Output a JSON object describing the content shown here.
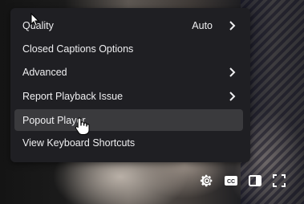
{
  "menu": {
    "items": [
      {
        "label": "Quality",
        "value": "Auto",
        "has_submenu": true
      },
      {
        "label": "Closed Captions Options",
        "value": "",
        "has_submenu": false
      },
      {
        "label": "Advanced",
        "value": "",
        "has_submenu": true
      },
      {
        "label": "Report Playback Issue",
        "value": "",
        "has_submenu": true
      },
      {
        "label": "Popout Player",
        "value": "",
        "has_submenu": false
      },
      {
        "label": "View Keyboard Shortcuts",
        "value": "",
        "has_submenu": false
      }
    ],
    "hovered_item": "Popout Player"
  },
  "controls": {
    "settings_icon": "gear-icon",
    "captions_icon": "cc-icon",
    "captions_label": "CC",
    "theatre_icon": "theatre-mode-icon",
    "fullscreen_icon": "fullscreen-icon"
  },
  "colors": {
    "menu_bg": "#1f1f23",
    "hover_bg": "#3a3a3d",
    "text": "#efeff1"
  }
}
